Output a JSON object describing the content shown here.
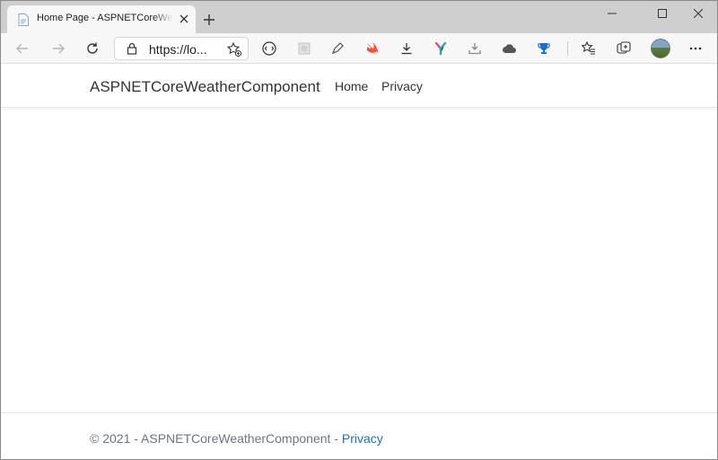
{
  "browser": {
    "tab": {
      "title": "Home Page - ASPNETCoreWeatherComponent"
    },
    "address": {
      "url": "https://lo..."
    },
    "icons": {
      "favicon": "document-icon",
      "close": "close-icon",
      "new_tab": "plus-icon",
      "back": "arrow-left-icon",
      "forward": "arrow-right-icon",
      "refresh": "refresh-icon",
      "lock": "lock-icon",
      "favorite_add": "star-plus-icon",
      "extensions": [
        "reader-icon",
        "puzzle-icon",
        "pen-icon",
        "swift-icon",
        "download-icon",
        "y-logo-icon",
        "tray-download-icon",
        "cloud-icon",
        "trophy-icon"
      ],
      "favorites": "favorites-icon",
      "collections": "collections-icon",
      "menu": "more-icon"
    },
    "colors": {
      "swift": "#f05138",
      "y_logo_pink": "#e8459a",
      "y_logo_teal": "#2aa8a0",
      "trophy": "#1a6fd6"
    }
  },
  "page": {
    "brand": "ASPNETCoreWeatherComponent",
    "nav": [
      {
        "label": "Home"
      },
      {
        "label": "Privacy"
      }
    ],
    "footer": {
      "copyright": "© 2021 - ASPNETCoreWeatherComponent - ",
      "privacy_link": "Privacy"
    },
    "colors": {
      "link": "#1b6ec2",
      "text": "#333333",
      "muted": "#6c757d"
    }
  }
}
